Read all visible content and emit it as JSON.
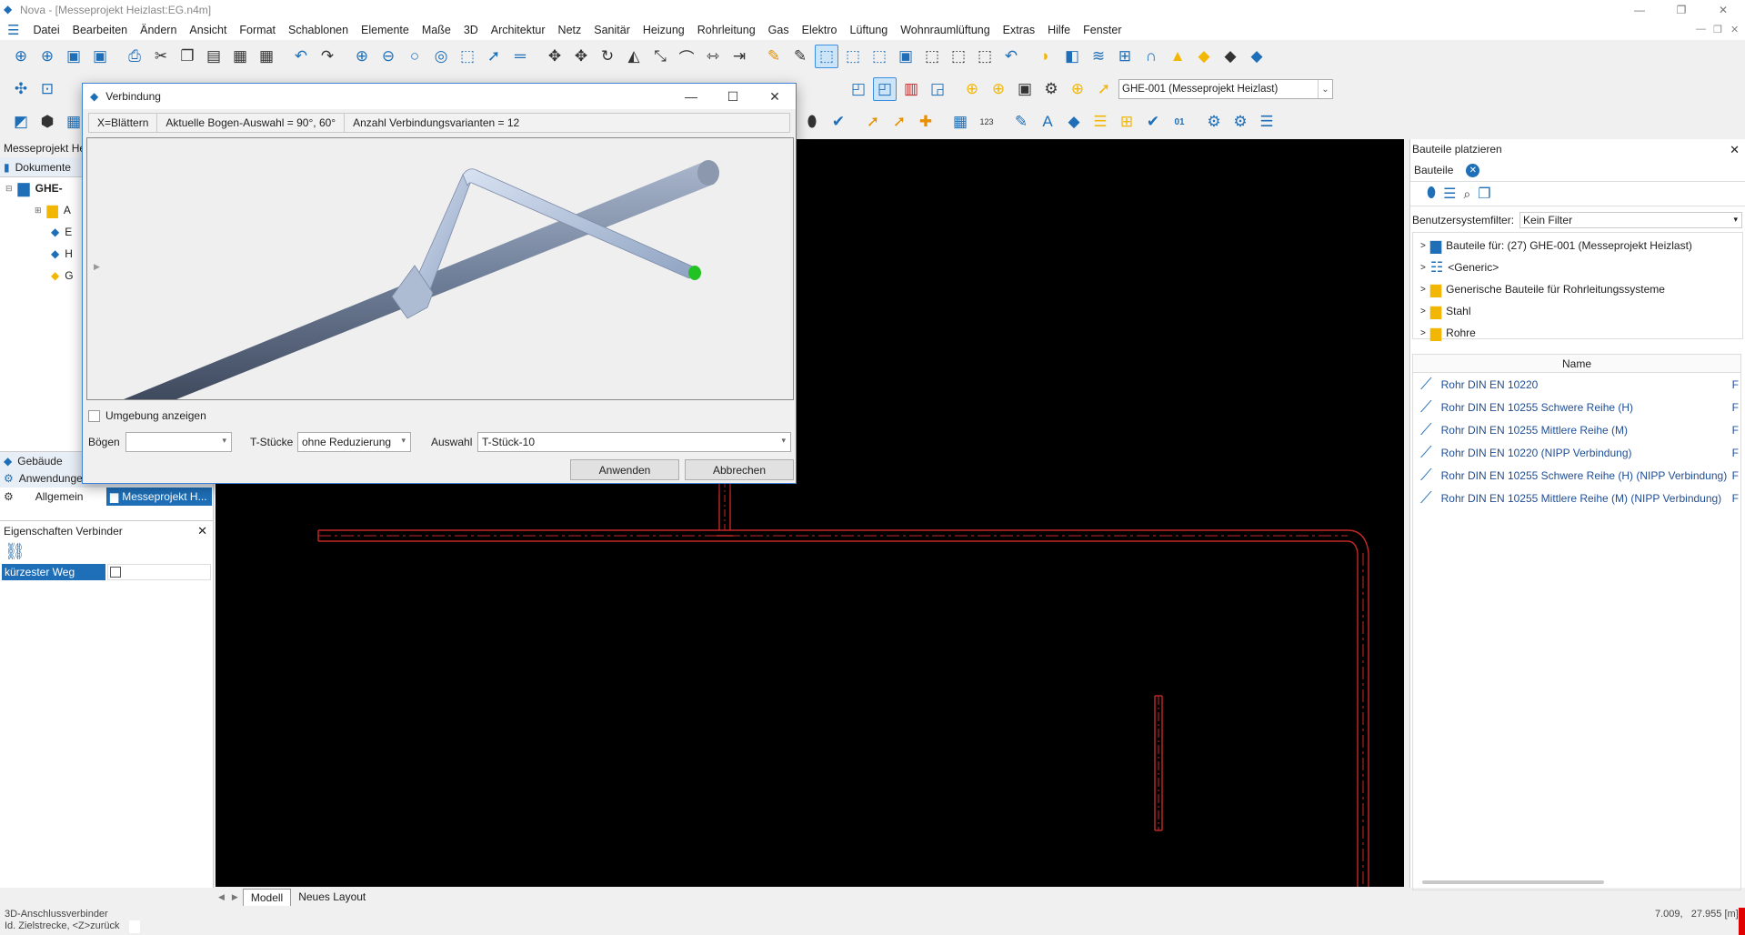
{
  "app": {
    "title": "Nova - [Messeprojekt Heizlast:EG.n4m]"
  },
  "menu": [
    "Datei",
    "Bearbeiten",
    "Ändern",
    "Ansicht",
    "Format",
    "Schablonen",
    "Elemente",
    "Maße",
    "3D",
    "Architektur",
    "Netz",
    "Sanitär",
    "Heizung",
    "Rohrleitung",
    "Gas",
    "Elektro",
    "Lüftung",
    "Wohnraumlüftung",
    "Extras",
    "Hilfe",
    "Fenster"
  ],
  "toolbar": {
    "project_select": "GHE-001 (Messeprojekt Heizlast)",
    "icon_label_123": "123",
    "icon_label_01": "01"
  },
  "left": {
    "project_header": "Messeprojekt He",
    "documents_tab": "Dokumente",
    "tree_root": "GHE-",
    "tree_letters": [
      "A",
      "E",
      "H",
      "G"
    ],
    "bottom_tabs": {
      "gebaeude": "Gebäude",
      "anwendungen": "Anwendungen",
      "allgemein": "Allgemein",
      "messeprojekt": "Messeprojekt H..."
    },
    "properties_title": "Eigenschaften Verbinder",
    "property_label": "kürzester Weg"
  },
  "dialog": {
    "title": "Verbindung",
    "info": [
      "X=Blättern",
      "Aktuelle Bogen-Auswahl = 90°, 60°",
      "Anzahl Verbindungsvarianten = 12"
    ],
    "show_surroundings": "Umgebung anzeigen",
    "boegen_label": "Bögen",
    "boegen_value": "",
    "tstuecke_label": "T-Stücke",
    "tstuecke_value": "ohne Reduzierung",
    "auswahl_label": "Auswahl",
    "auswahl_value": "T-Stück-10",
    "apply": "Anwenden",
    "cancel": "Abbrechen"
  },
  "canvas": {
    "tabs": [
      "Modell",
      "Neues Layout"
    ]
  },
  "right": {
    "title": "Bauteile platzieren",
    "tab": "Bauteile",
    "filter_label": "Benutzersystemfilter:",
    "filter_value": "Kein Filter",
    "tree": [
      "Bauteile für: (27) GHE-001 (Messeprojekt Heizlast)",
      "<Generic>",
      "Generische Bauteile für Rohrleitungssysteme",
      "Stahl",
      "Rohre"
    ],
    "column_header": "Name",
    "components": [
      "Rohr DIN EN 10220",
      "Rohr DIN EN 10255 Schwere Reihe (H)",
      "Rohr DIN EN 10255 Mittlere Reihe (M)",
      "Rohr DIN EN 10220 (NIPP Verbindung)",
      "Rohr DIN EN 10255 Schwere Reihe (H) (NIPP Verbindung)",
      "Rohr DIN EN 10255 Mittlere Reihe (M) (NIPP Verbindung)"
    ],
    "component_suffix": "F"
  },
  "status": {
    "line1": "3D-Anschlussverbinder",
    "line2": "Id. Zielstrecke, <Z>zurück",
    "coords": "7.009,   27.955 [m]"
  },
  "colors": {
    "accent": "#1e6fb8",
    "canvas": "#000000",
    "wire": "#c62828",
    "endpoint": "#22c222"
  }
}
